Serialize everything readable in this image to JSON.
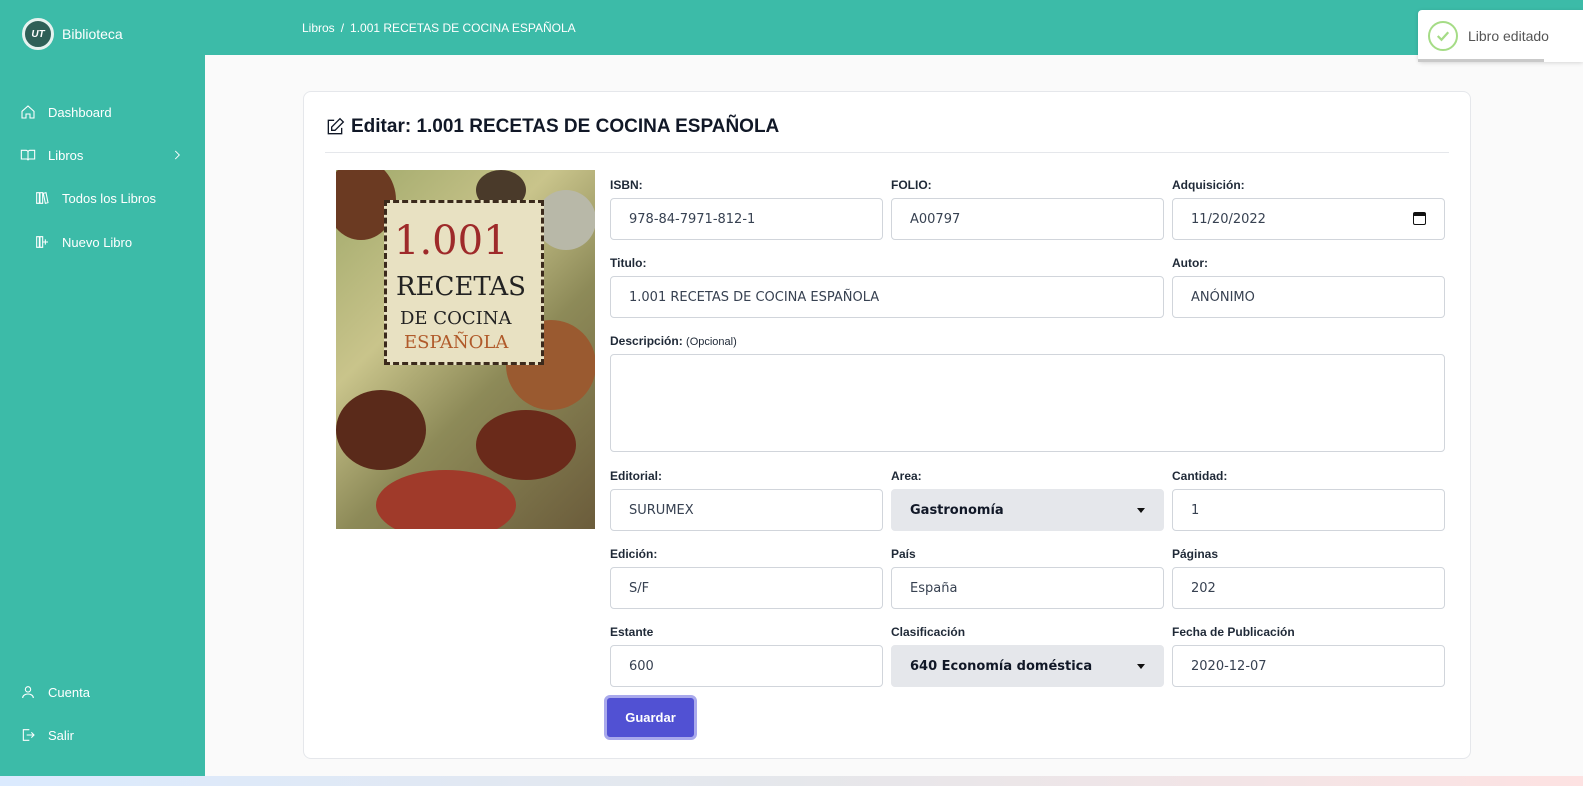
{
  "app": {
    "brand_name": "Biblioteca",
    "logo_text": "UT"
  },
  "sidebar": {
    "items": [
      {
        "label": "Dashboard",
        "icon": "home-icon"
      },
      {
        "label": "Libros",
        "icon": "book-open-icon"
      },
      {
        "label": "Todos los Libros",
        "icon": "books-icon"
      },
      {
        "label": "Nuevo Libro",
        "icon": "book-add-icon"
      },
      {
        "label": "Cuenta",
        "icon": "user-icon"
      },
      {
        "label": "Salir",
        "icon": "logout-icon"
      }
    ]
  },
  "breadcrumb": {
    "root": "Libros",
    "sep": "/",
    "current": "1.001 RECETAS DE COCINA ESPAÑOLA"
  },
  "toast": {
    "message": "Libro editado",
    "status": "success"
  },
  "page": {
    "title": "Editar: 1.001 RECETAS DE COCINA ESPAÑOLA"
  },
  "cover": {
    "line1": "1.001",
    "line2": "RECETAS",
    "line3": "DE COCINA",
    "line4": "ESPAÑOLA"
  },
  "form": {
    "isbn": {
      "label": "ISBN:",
      "value": "978-84-7971-812-1"
    },
    "folio": {
      "label": "FOLIO:",
      "value": "A00797"
    },
    "adquisicion": {
      "label": "Adquisición:",
      "value": "11/20/2022"
    },
    "titulo": {
      "label": "Titulo:",
      "value": "1.001 RECETAS DE COCINA ESPAÑOLA"
    },
    "autor": {
      "label": "Autor:",
      "value": "ANÓNIMO"
    },
    "descripcion": {
      "label": "Descripción:",
      "optional": "(Opcional)",
      "value": ""
    },
    "editorial": {
      "label": "Editorial:",
      "value": "SURUMEX"
    },
    "area": {
      "label": "Area:",
      "value": "Gastronomía"
    },
    "cantidad": {
      "label": "Cantidad:",
      "value": "1"
    },
    "edicion": {
      "label": "Edición:",
      "value": "S/F"
    },
    "pais": {
      "label": "País",
      "value": "España"
    },
    "paginas": {
      "label": "Páginas",
      "value": "202"
    },
    "estante": {
      "label": "Estante",
      "value": "600"
    },
    "clasificacion": {
      "label": "Clasificación",
      "value": "640 Economía doméstica"
    },
    "fecha_publicacion": {
      "label": "Fecha de Publicación",
      "value": "2020-12-07"
    },
    "submit_label": "Guardar"
  },
  "colors": {
    "primary": "#3cbba8",
    "button": "#5151d3",
    "success": "#a5dc86"
  }
}
